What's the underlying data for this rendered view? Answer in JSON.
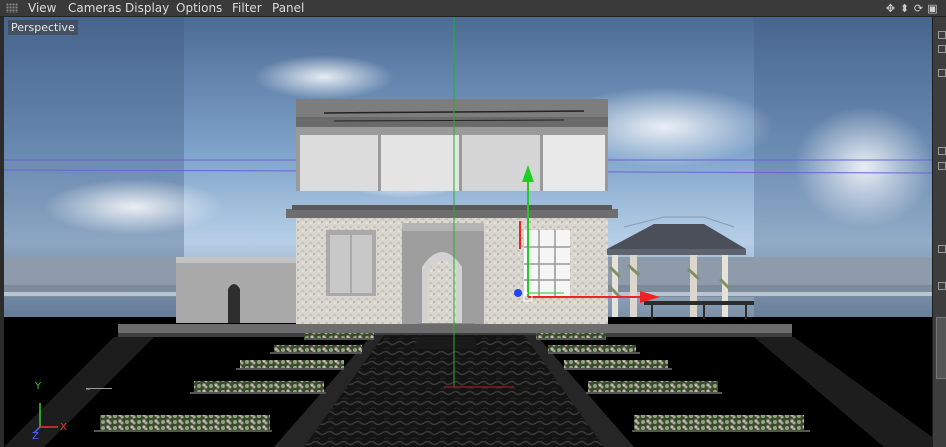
{
  "menu": {
    "items": [
      "View",
      "Cameras",
      "Display",
      "Options",
      "Filter",
      "Panel"
    ]
  },
  "viewport": {
    "label": "Perspective"
  },
  "axis_gizmo": {
    "y": "Y",
    "z": "Z",
    "x": "X"
  },
  "icons": [
    "move-view-icon",
    "dolly-icon",
    "rotate-view-icon",
    "maximize-view-icon"
  ],
  "colors": {
    "sky_top": "#4f6f97",
    "sky_horizon": "#a6c4e3",
    "ground": "#000000",
    "axis_y": "#22cc22",
    "axis_x": "#ee2222",
    "axis_z": "#2244ee"
  }
}
